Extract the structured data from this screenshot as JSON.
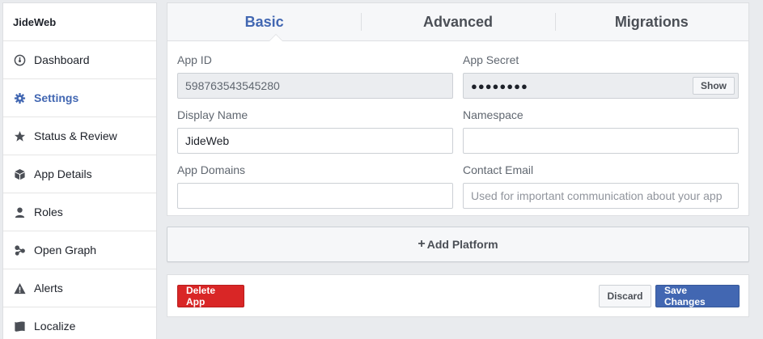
{
  "sidebar": {
    "app_name": "JideWeb",
    "items": [
      {
        "label": "Dashboard",
        "icon": "dashboard-icon"
      },
      {
        "label": "Settings",
        "icon": "gear-icon",
        "active": true
      },
      {
        "label": "Status & Review",
        "icon": "star-icon"
      },
      {
        "label": "App Details",
        "icon": "cube-icon"
      },
      {
        "label": "Roles",
        "icon": "person-icon"
      },
      {
        "label": "Open Graph",
        "icon": "share-nodes-icon"
      },
      {
        "label": "Alerts",
        "icon": "warning-icon"
      },
      {
        "label": "Localize",
        "icon": "flag-icon"
      }
    ]
  },
  "tabs": [
    {
      "label": "Basic",
      "active": true
    },
    {
      "label": "Advanced"
    },
    {
      "label": "Migrations"
    }
  ],
  "form": {
    "app_id": {
      "label": "App ID",
      "value": "598763543545280"
    },
    "app_secret": {
      "label": "App Secret",
      "value": "●●●●●●●●",
      "show_label": "Show"
    },
    "display_name": {
      "label": "Display Name",
      "value": "JideWeb"
    },
    "namespace": {
      "label": "Namespace",
      "value": ""
    },
    "app_domains": {
      "label": "App Domains",
      "value": ""
    },
    "contact_email": {
      "label": "Contact Email",
      "value": "",
      "placeholder": "Used for important communication about your app"
    }
  },
  "add_platform": {
    "plus": "+",
    "label": "Add Platform"
  },
  "actions": {
    "delete_label": "Delete App",
    "discard_label": "Discard",
    "save_label": "Save Changes"
  },
  "colors": {
    "accent": "#4267b2",
    "danger": "#d92626",
    "background": "#e9ebee"
  }
}
